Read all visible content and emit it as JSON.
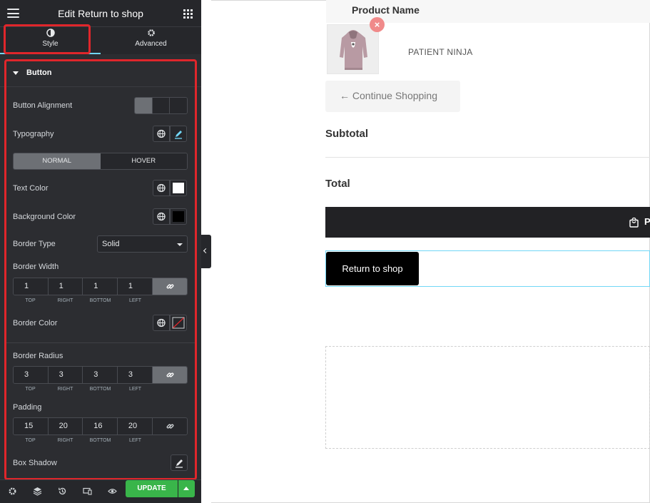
{
  "panel": {
    "title": "Edit Return to shop",
    "tabs": [
      {
        "label": "Style",
        "active": true
      },
      {
        "label": "Advanced",
        "active": false
      }
    ],
    "section": "Button",
    "controls": {
      "button_alignment": "Button Alignment",
      "typography": "Typography",
      "state_tabs": [
        "NORMAL",
        "HOVER"
      ],
      "text_color": {
        "label": "Text Color",
        "value": "#ffffff"
      },
      "background_color": {
        "label": "Background Color",
        "value": "#000000"
      },
      "border_type": {
        "label": "Border Type",
        "value": "Solid"
      },
      "border_width": {
        "label": "Border Width",
        "values": [
          "1",
          "1",
          "1",
          "1"
        ]
      },
      "border_color": "Border Color",
      "border_radius": {
        "label": "Border Radius",
        "values": [
          "3",
          "3",
          "3",
          "3"
        ]
      },
      "padding": {
        "label": "Padding",
        "values": [
          "15",
          "20",
          "16",
          "20"
        ]
      },
      "box_shadow": "Box Shadow",
      "dim_caps": [
        "TOP",
        "RIGHT",
        "BOTTOM",
        "LEFT"
      ]
    },
    "footer": {
      "update_label": "UPDATE"
    }
  },
  "preview": {
    "product_header": "Product Name",
    "remove_symbol": "×",
    "product_name": "PATIENT NINJA",
    "continue_label": "← Continue Shopping",
    "subtotal_label": "Subtotal",
    "total_label": "Total",
    "checkout_partial": "P",
    "return_button": "Return to shop"
  },
  "colors": {
    "accent_green": "#39b54a",
    "highlight_red": "#e0262b",
    "selection_cyan": "#71d7f7"
  }
}
